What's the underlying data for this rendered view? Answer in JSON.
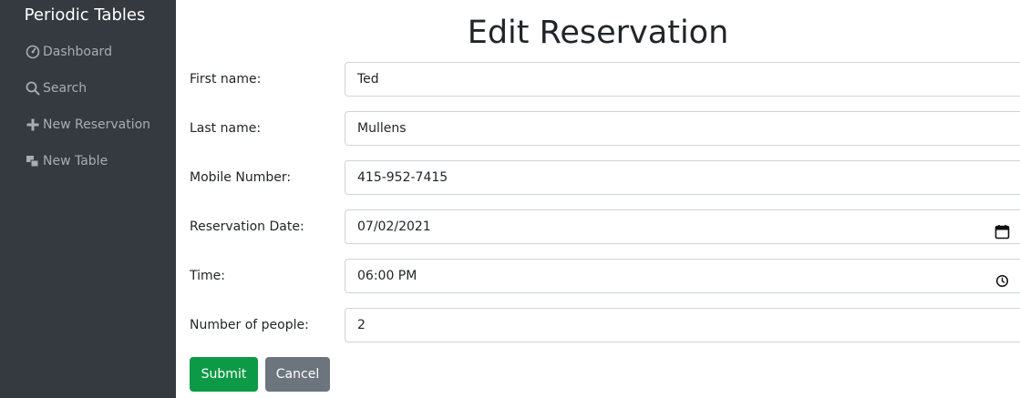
{
  "sidebar": {
    "brand": "Periodic Tables",
    "items": [
      {
        "label": "Dashboard",
        "icon": "dashboard-icon"
      },
      {
        "label": "Search",
        "icon": "search-icon"
      },
      {
        "label": "New Reservation",
        "icon": "plus-icon"
      },
      {
        "label": "New Table",
        "icon": "new-table-icon"
      }
    ]
  },
  "form": {
    "title": "Edit Reservation",
    "fields": [
      {
        "label": "First name:",
        "value": "Ted"
      },
      {
        "label": "Last name:",
        "value": "Mullens"
      },
      {
        "label": "Mobile Number:",
        "value": "415-952-7415"
      },
      {
        "label": "Reservation Date:",
        "value": "07/02/2021",
        "icon": "calendar-icon"
      },
      {
        "label": "Time:",
        "value": "06:00 PM",
        "icon": "clock-icon"
      },
      {
        "label": "Number of people:",
        "value": "2"
      }
    ],
    "submit_label": "Submit",
    "cancel_label": "Cancel"
  },
  "colors": {
    "sidebar_bg": "#343a40",
    "submit_bg": "#0d9a46",
    "cancel_bg": "#6c757d"
  }
}
